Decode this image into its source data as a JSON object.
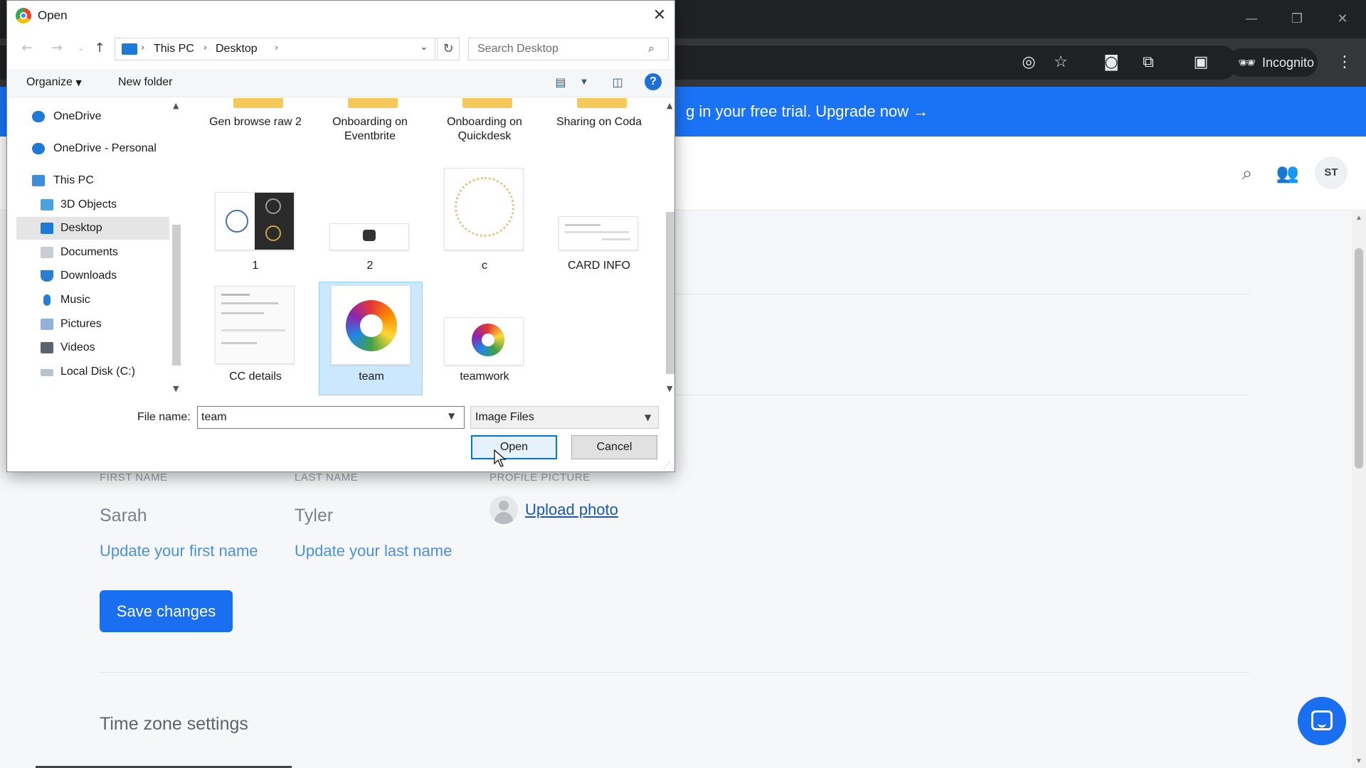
{
  "browser": {
    "incognito_label": "Incognito",
    "min_icon": "minimize-icon",
    "restore_icon": "restore-icon",
    "close_icon": "close-icon"
  },
  "banner": {
    "text": "g in your free trial. Upgrade now →"
  },
  "header": {
    "avatar_initials": "ST"
  },
  "profile": {
    "first_name_label": "FIRST NAME",
    "last_name_label": "LAST NAME",
    "profile_picture_label": "PROFILE PICTURE",
    "first_name": "Sarah",
    "last_name": "Tyler",
    "first_name_hint": "Update your first name",
    "last_name_hint": "Update your last name",
    "upload_photo": "Upload photo",
    "save_button": "Save changes",
    "timezone_title": "Time zone settings"
  },
  "dialog": {
    "title": "Open",
    "breadcrumb": [
      "This PC",
      "Desktop"
    ],
    "search_placeholder": "Search Desktop",
    "organize": "Organize",
    "new_folder": "New folder",
    "nav_items": [
      {
        "label": "OneDrive"
      },
      {
        "label": "OneDrive - Personal"
      },
      {
        "label": "This PC"
      },
      {
        "label": "3D Objects"
      },
      {
        "label": "Desktop"
      },
      {
        "label": "Documents"
      },
      {
        "label": "Downloads"
      },
      {
        "label": "Music"
      },
      {
        "label": "Pictures"
      },
      {
        "label": "Videos"
      },
      {
        "label": "Local Disk (C:)"
      }
    ],
    "files": [
      {
        "name": "Gen browse raw 2"
      },
      {
        "name": "Onboarding on Eventbrite"
      },
      {
        "name": "Onboarding on Quickdesk"
      },
      {
        "name": "Sharing on Coda"
      },
      {
        "name": "1"
      },
      {
        "name": "2"
      },
      {
        "name": "c"
      },
      {
        "name": "CARD INFO"
      },
      {
        "name": "CC details"
      },
      {
        "name": "team"
      },
      {
        "name": "teamwork"
      }
    ],
    "selected_file": "team",
    "file_name_label": "File name:",
    "file_name_value": "team",
    "file_type": "Image Files",
    "open_button": "Open",
    "cancel_button": "Cancel"
  },
  "colors": {
    "accent": "#1a6ff0",
    "banner": "#1a73f5",
    "selection": "#cce8ff"
  }
}
